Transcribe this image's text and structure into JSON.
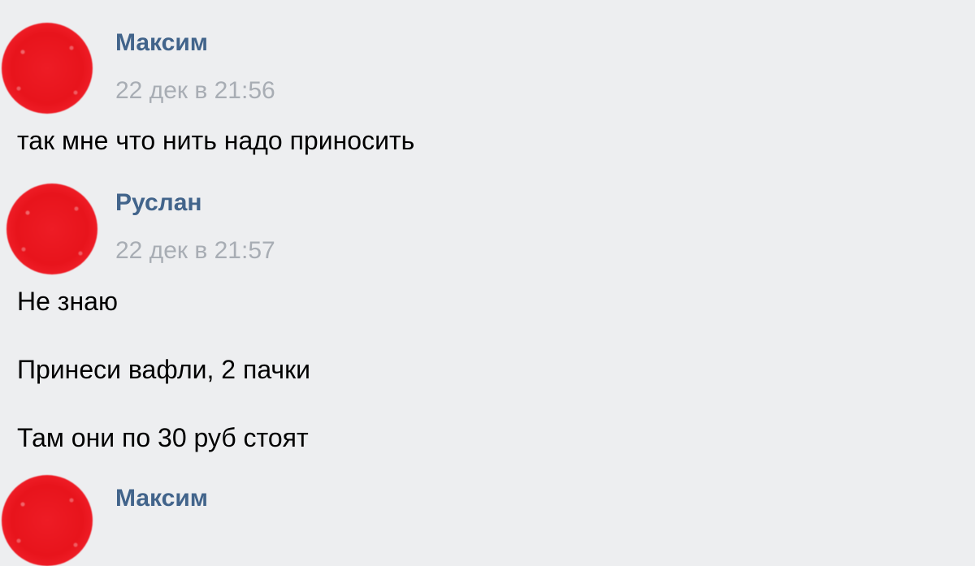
{
  "messages": [
    {
      "author": "Максим",
      "time": "22 дек в 21:56",
      "lines": [
        "так мне что нить надо приносить"
      ]
    },
    {
      "author": "Руслан",
      "time": "22 дек в 21:57",
      "lines": [
        "Не знаю",
        "Принеси вафли, 2 пачки",
        "Там они по 30 руб стоят"
      ]
    },
    {
      "author": "Максим"
    }
  ],
  "colors": {
    "background": "#edeef0",
    "author": "#42648b",
    "time": "#a8adb4",
    "text": "#000000",
    "avatar": "#ee1c25"
  }
}
